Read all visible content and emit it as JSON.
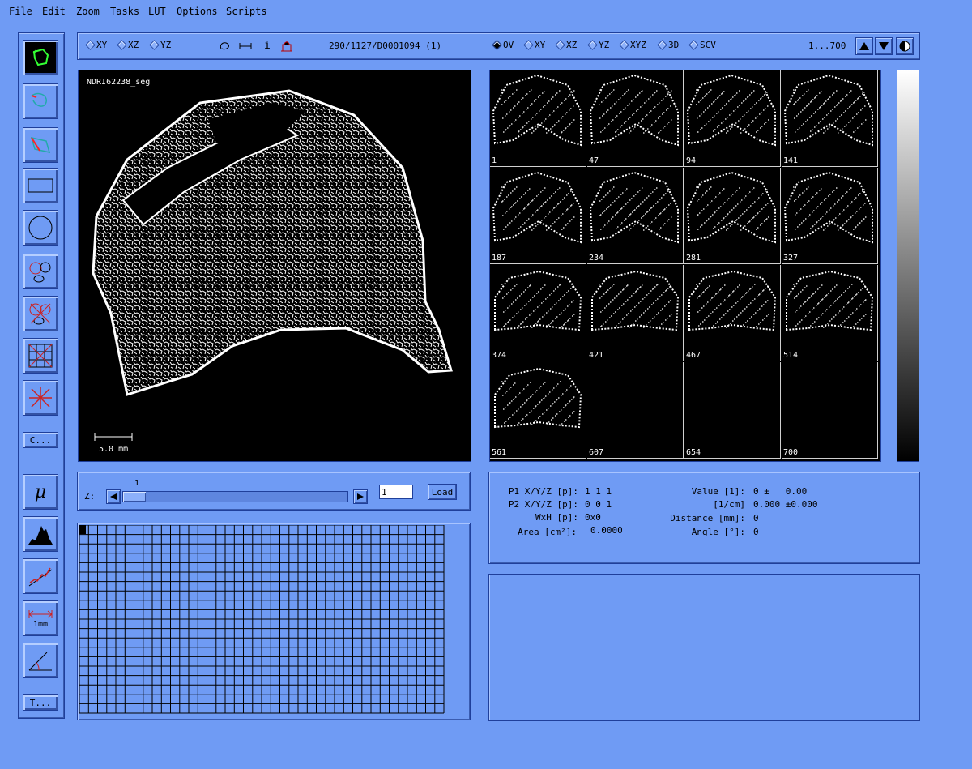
{
  "menu": [
    "File",
    "Edit",
    "Zoom",
    "Tasks",
    "LUT",
    "Options",
    "Scripts"
  ],
  "toolbar": {
    "views": [
      "XY",
      "XZ",
      "YZ"
    ],
    "info_text": "290/1127/D0001094 (1)",
    "overview_views": [
      "OV",
      "XY",
      "XZ",
      "YZ",
      "XYZ",
      "3D",
      "SCV"
    ],
    "range_text": "1...700"
  },
  "left_tools": {
    "c_button": "C...",
    "t_button": "T...",
    "measure_label": "1mm",
    "mu_symbol": "μ"
  },
  "main_view": {
    "title": "NDRI62238_seg",
    "scale_label": "5.0 mm"
  },
  "thumbnails": [
    "1",
    "47",
    "94",
    "141",
    "187",
    "234",
    "281",
    "327",
    "374",
    "421",
    "467",
    "514",
    "561",
    "607",
    "654",
    "700"
  ],
  "slider": {
    "label": "Z:",
    "value_label": "1",
    "input_value": "1",
    "load_label": "Load",
    "position_fraction": 0.0
  },
  "info": {
    "p1_label": "P1 X/Y/Z [p]:",
    "p1_value": "1 1 1",
    "p2_label": "P2 X/Y/Z [p]:",
    "p2_value": "0 0 1",
    "wxh_label": "WxH [p]:",
    "wxh_value": "0x0",
    "area_label": "Area [cm²]:",
    "area_value": "0.0000",
    "value_label": "Value [1]:",
    "value_value": "0 ±   0.00",
    "cm_label": "[1/cm]",
    "cm_value": "0.000 ±0.000",
    "distance_label": "Distance [mm]:",
    "distance_value": "0",
    "angle_label": "Angle [°]:",
    "angle_value": "0"
  }
}
